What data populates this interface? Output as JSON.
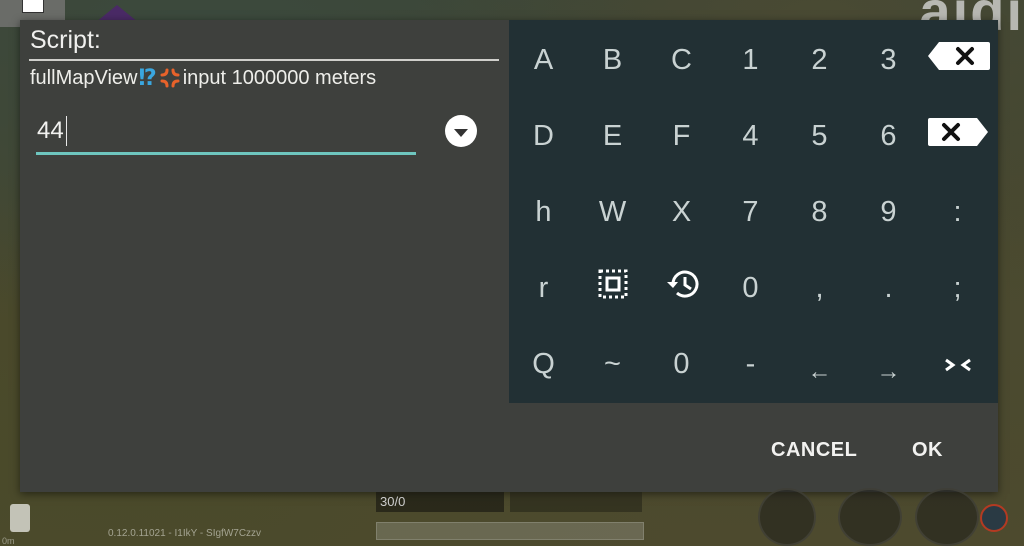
{
  "background": {
    "top_right_title": "aidi",
    "version_text": "0.12.0.11021 - I1IkY - SIgfW7Czzv",
    "distance_text": "0m",
    "ammo_text": "30/0"
  },
  "corner_button": {
    "icon": "square-icon"
  },
  "dialog": {
    "title": "Script:",
    "description_prefix": "fullMapView",
    "description_emoji_1": "⁉",
    "description_emoji_2": "anger-symbol",
    "description_suffix": "input 1000000 meters",
    "input": {
      "value": "44",
      "placeholder": ""
    },
    "dropdown_icon": "chevron-down-circle-icon",
    "accent_color": "#6ec6bf",
    "actions": {
      "cancel": "CANCEL",
      "ok": "OK"
    }
  },
  "keyboard": {
    "background_color": "#223034",
    "rows": [
      [
        {
          "label": "A"
        },
        {
          "label": "B"
        },
        {
          "label": "C"
        },
        {
          "label": "1"
        },
        {
          "label": "2"
        },
        {
          "label": "3"
        },
        {
          "label": "",
          "icon": "backspace-icon"
        }
      ],
      [
        {
          "label": "D"
        },
        {
          "label": "E"
        },
        {
          "label": "F"
        },
        {
          "label": "4"
        },
        {
          "label": "5"
        },
        {
          "label": "6"
        },
        {
          "label": "",
          "icon": "delete-forward-icon"
        }
      ],
      [
        {
          "label": "h"
        },
        {
          "label": "W"
        },
        {
          "label": "X"
        },
        {
          "label": "7"
        },
        {
          "label": "8"
        },
        {
          "label": "9"
        },
        {
          "label": ":"
        }
      ],
      [
        {
          "label": "r"
        },
        {
          "label": "",
          "icon": "select-all-icon"
        },
        {
          "label": "",
          "icon": "history-icon"
        },
        {
          "label": "0"
        },
        {
          "label": ","
        },
        {
          "label": "."
        },
        {
          "label": ";"
        }
      ],
      [
        {
          "label": "Q"
        },
        {
          "label": "~"
        },
        {
          "label": "0"
        },
        {
          "label": "-"
        },
        {
          "label": "←"
        },
        {
          "label": "→"
        },
        {
          "label": "",
          "icon": "collapse-icon"
        }
      ]
    ]
  }
}
